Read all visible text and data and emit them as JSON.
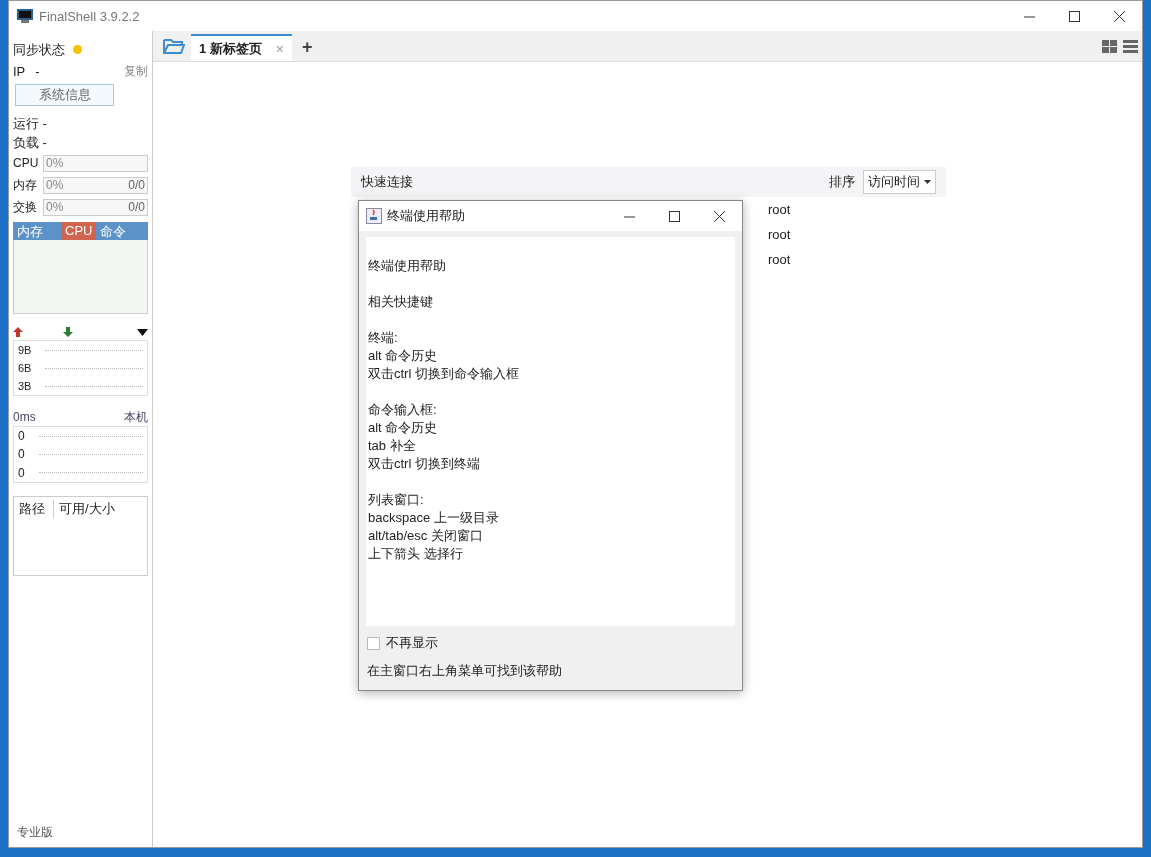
{
  "window": {
    "title": "FinalShell 3.9.2.2"
  },
  "sidebar": {
    "sync": {
      "label": "同步状态",
      "color": "#f5c400"
    },
    "ip": {
      "label": "IP",
      "value": "-",
      "copy": "复制"
    },
    "sysinfo_button": "系统信息",
    "stats": [
      "运行 -",
      "负载 -"
    ],
    "meters": [
      {
        "label": "CPU",
        "reading": "0%",
        "level": 0
      },
      {
        "label": "内存",
        "reading": "0%",
        "total": "0/0",
        "level": 0
      },
      {
        "label": "交换",
        "reading": "0%",
        "total": "0/0",
        "level": 0
      }
    ],
    "monitor_tabs": [
      {
        "label": "内存",
        "selected": false
      },
      {
        "label": "CPU",
        "selected": true
      },
      {
        "label": "命令",
        "selected": false
      }
    ],
    "network": {
      "ticks": [
        "9B",
        "6B",
        "3B"
      ]
    },
    "ping": {
      "latency": "0ms",
      "host": "本机",
      "ticks": [
        "0",
        "0",
        "0"
      ]
    },
    "disk_columns": [
      "路径",
      "可用/大小"
    ],
    "edition": "专业版"
  },
  "tabs": [
    {
      "label": "1 新标签页",
      "selected": true,
      "close": "×"
    }
  ],
  "add_tab": "+",
  "quick_connect": {
    "title": "快速连接",
    "sort_label": "排序",
    "sort_value": "访问时间",
    "rows": [
      {
        "column_2": "root"
      },
      {
        "column_2": "root"
      },
      {
        "column_2": "root"
      }
    ]
  },
  "dialog": {
    "title": "终端使用帮助",
    "sections": [
      {
        "lines": [
          "终端使用帮助"
        ]
      },
      {
        "lines": [
          "相关快捷键"
        ]
      },
      {
        "lines": [
          "终端:",
          "alt 命令历史",
          "双击ctrl 切换到命令输入框"
        ]
      },
      {
        "lines": [
          "命令输入框:",
          "alt 命令历史",
          "tab 补全",
          "双击ctrl 切换到终端"
        ]
      },
      {
        "lines": [
          "列表窗口:",
          "backspace 上一级目录",
          "alt/tab/esc 关闭窗口",
          "上下箭头 选择行"
        ]
      }
    ],
    "dont_show": {
      "label": "不再显示",
      "checked": false
    },
    "footer": "在主窗口右上角菜单可找到该帮助"
  }
}
